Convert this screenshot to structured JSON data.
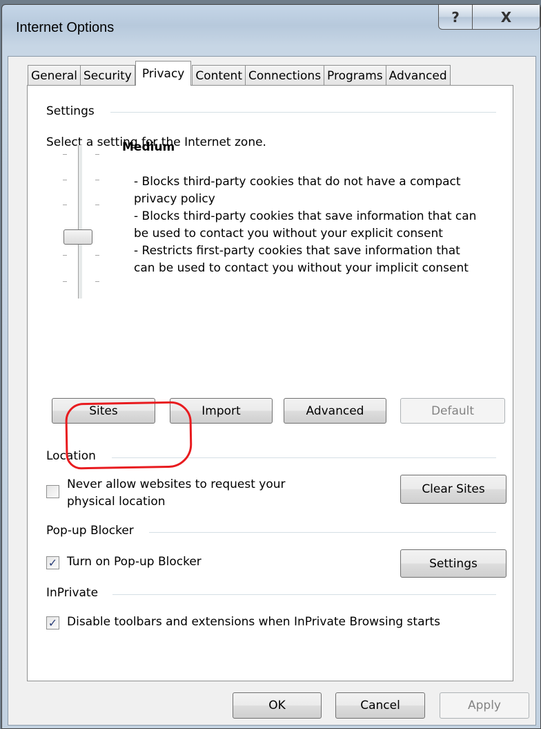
{
  "window": {
    "title": "Internet Options",
    "help_glyph": "?",
    "close_glyph": "X"
  },
  "tabs": [
    {
      "label": "General"
    },
    {
      "label": "Security"
    },
    {
      "label": "Privacy"
    },
    {
      "label": "Content"
    },
    {
      "label": "Connections"
    },
    {
      "label": "Programs"
    },
    {
      "label": "Advanced"
    }
  ],
  "active_tab": "Privacy",
  "settings": {
    "group_label": "Settings",
    "prompt": "Select a setting for the Internet zone.",
    "level": "Medium",
    "slider_position": "3 of 6",
    "description_lines": [
      "- Blocks third-party cookies that do not have a compact",
      "privacy policy",
      "- Blocks third-party cookies that save information that can",
      "be used to contact you without your explicit consent",
      "- Restricts first-party cookies that save information that",
      "can be used to contact you without your implicit consent"
    ],
    "buttons": {
      "sites": "Sites",
      "import": "Import",
      "advanced": "Advanced",
      "default": "Default"
    }
  },
  "location": {
    "group_label": "Location",
    "checkbox_line1": "Never allow websites to request your",
    "checkbox_line2": "physical location",
    "checked": false,
    "clear_sites": "Clear Sites"
  },
  "popup": {
    "group_label": "Pop-up Blocker",
    "checkbox_label": "Turn on Pop-up Blocker",
    "checked": true,
    "settings_button": "Settings"
  },
  "inprivate": {
    "group_label": "InPrivate",
    "checkbox_label": "Disable toolbars and extensions when InPrivate Browsing starts",
    "checked": true
  },
  "footer": {
    "ok": "OK",
    "cancel": "Cancel",
    "apply": "Apply"
  },
  "check_glyph": "✓",
  "colors": {
    "annotation": "#e81b1f",
    "check": "#2b3f7a"
  }
}
